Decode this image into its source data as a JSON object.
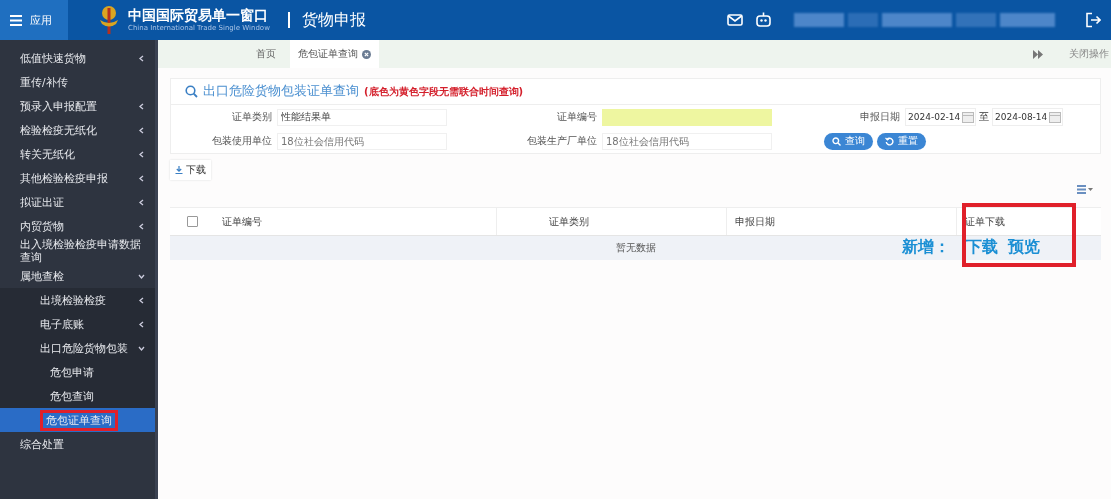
{
  "header": {
    "menu_label": "应用",
    "title": "中国国际贸易单一窗口",
    "subtitle": "China International Trade Single Window",
    "module": "货物申报"
  },
  "tabs": [
    {
      "label": "首页",
      "selected": false,
      "closable": false
    },
    {
      "label": "危包证单查询",
      "selected": true,
      "closable": true
    }
  ],
  "tab_bar_action": "关闭操作",
  "sidebar": {
    "items": [
      {
        "label": "低值快速货物",
        "expanded": false,
        "selected": false
      },
      {
        "label": "重传/补传",
        "selected": false
      },
      {
        "label": "预录入申报配置",
        "expanded": false,
        "selected": false
      },
      {
        "label": "检验检疫无纸化",
        "expanded": false,
        "selected": false
      },
      {
        "label": "转关无纸化",
        "expanded": false,
        "selected": false
      },
      {
        "label": "其他检验检疫申报",
        "expanded": false,
        "selected": false
      },
      {
        "label": "拟证出证",
        "expanded": false,
        "selected": false
      },
      {
        "label": "内贸货物",
        "expanded": false,
        "selected": false
      },
      {
        "label": "出入境检验检疫申请数据查询",
        "selected": false
      },
      {
        "label": "属地查检",
        "expanded": true,
        "selected": false,
        "children": [
          {
            "label": "出境检验检疫",
            "expanded": false,
            "selected": false
          },
          {
            "label": "电子底账",
            "expanded": false,
            "selected": false
          },
          {
            "label": "出口危险货物包装",
            "expanded": true,
            "selected": false,
            "children": [
              {
                "label": "危包申请",
                "selected": false
              },
              {
                "label": "危包查询",
                "selected": false
              },
              {
                "label": "危包证单查询",
                "selected": true
              }
            ]
          }
        ]
      },
      {
        "label": "综合处置",
        "selected": false
      }
    ]
  },
  "query": {
    "title": "出口危险货物包装证单查询",
    "hint": "(底色为黄色字段无需联合时间查询)",
    "fields": [
      {
        "label": "证单类别",
        "value": "性能结果单",
        "highlighted": false
      },
      {
        "label": "证单编号",
        "highlighted": true
      },
      {
        "label": "包装使用单位",
        "placeholder": "18位社会信用代码",
        "highlighted": false
      },
      {
        "label": "包装生产厂单位",
        "placeholder": "18位社会信用代码",
        "highlighted": false
      }
    ],
    "date": {
      "label": "申报日期",
      "from": "2024-02-14",
      "separator": "至",
      "to": "2024-08-14"
    },
    "buttons": [
      {
        "label": "查询",
        "kind": "search"
      },
      {
        "label": "重置",
        "kind": "reset"
      }
    ]
  },
  "download_button": "下载",
  "table": {
    "columns": [
      "证单编号",
      "证单类别",
      "申报日期",
      "证单下载"
    ],
    "all_checked": false,
    "empty_text": "暂无数据"
  },
  "annotation": {
    "prefix": "新增：",
    "items": [
      "下载",
      "预览"
    ]
  }
}
